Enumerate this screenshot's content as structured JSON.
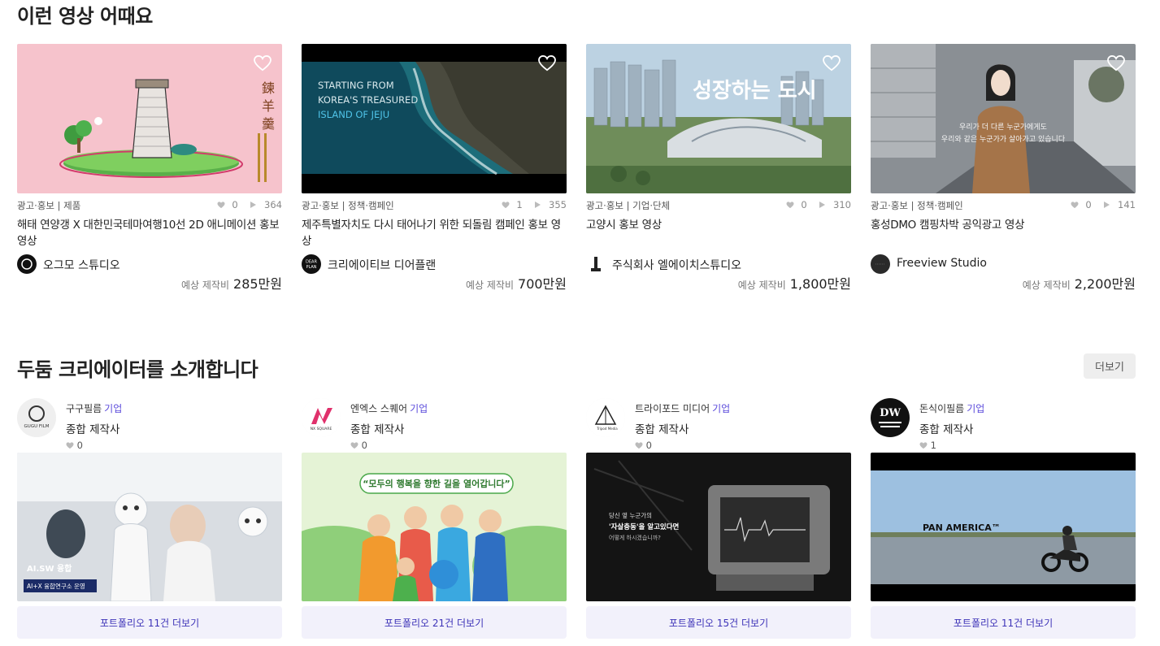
{
  "section1": {
    "title": "이런 영상 어때요"
  },
  "section2": {
    "title": "두둠 크리에이터를 소개합니다",
    "more_label": "더보기"
  },
  "price_label": "예상 제작비",
  "videos": [
    {
      "category": "광고·홍보 | 제품",
      "likes": "0",
      "views": "364",
      "title": "해태 연양갱 X 대한민국테마여행10선 2D 애니메이션 홍보 영상",
      "studio": "오그모 스튜디오",
      "price": "285만원"
    },
    {
      "category": "광고·홍보 | 정책·캠페인",
      "likes": "1",
      "views": "355",
      "title": "제주특별자치도 다시 태어나기 위한 되돌림 캠페인 홍보 영상",
      "studio": "크리에이티브 디어플랜",
      "price": "700만원",
      "overlay": [
        "STARTING FROM",
        "KOREA'S TREASURED",
        "ISLAND OF JEJU"
      ],
      "logo_text": [
        "DEAR",
        "PLAN"
      ]
    },
    {
      "category": "광고·홍보 | 기업·단체",
      "likes": "0",
      "views": "310",
      "title": "고양시 홍보 영상",
      "studio": "주식회사 엘에이치스튜디오",
      "price": "1,800만원",
      "overlay": [
        "성장하는 도시"
      ]
    },
    {
      "category": "광고·홍보 | 정책·캠페인",
      "likes": "0",
      "views": "141",
      "title": "홍성DMO 캠핑차박 공익광고 영상",
      "studio": "Freeview Studio",
      "price": "2,200만원",
      "overlay": [
        "우리가 더 다른 누군가에게도",
        "우리와 같은 누군가가 살아가고 있습니다"
      ]
    }
  ],
  "creators": [
    {
      "name": "구구필름",
      "badge": "기업",
      "type": "종합 제작사",
      "likes": "0",
      "portfolio": "포트폴리오 11건 더보기",
      "logo_text": [
        "GUGU FILM"
      ],
      "thumb_text": [
        "AI.SW 융합",
        "AI+X 융합연구소 운영"
      ]
    },
    {
      "name": "엔엑스 스퀘어",
      "badge": "기업",
      "type": "종합 제작사",
      "likes": "0",
      "portfolio": "포트폴리오 21건 더보기",
      "logo_text": [
        "NX SQUARE"
      ],
      "thumb_text": [
        "“모두의 행복을 향한 길을 열어갑니다”"
      ]
    },
    {
      "name": "트라이포드 미디어",
      "badge": "기업",
      "type": "종합 제작사",
      "likes": "0",
      "portfolio": "포트폴리오 15건 더보기",
      "logo_text": [
        "Tripod Media"
      ],
      "thumb_text": [
        "당신 옆 누군가의",
        "'자살충동'을 알고있다면",
        "어떻게 하시겠습니까?"
      ]
    },
    {
      "name": "돈식이필름",
      "badge": "기업",
      "type": "종합 제작사",
      "likes": "1",
      "portfolio": "포트폴리오 11건 더보기",
      "logo_text": [
        "DW"
      ],
      "thumb_text": [
        "PAN AMERICA™"
      ]
    }
  ],
  "icons": {
    "heart": "heart-icon",
    "play": "play-icon"
  },
  "colors": {
    "accent": "#5b4bdb",
    "portfolio_bg": "#f2f1fb",
    "portfolio_text": "#3d33b8"
  }
}
